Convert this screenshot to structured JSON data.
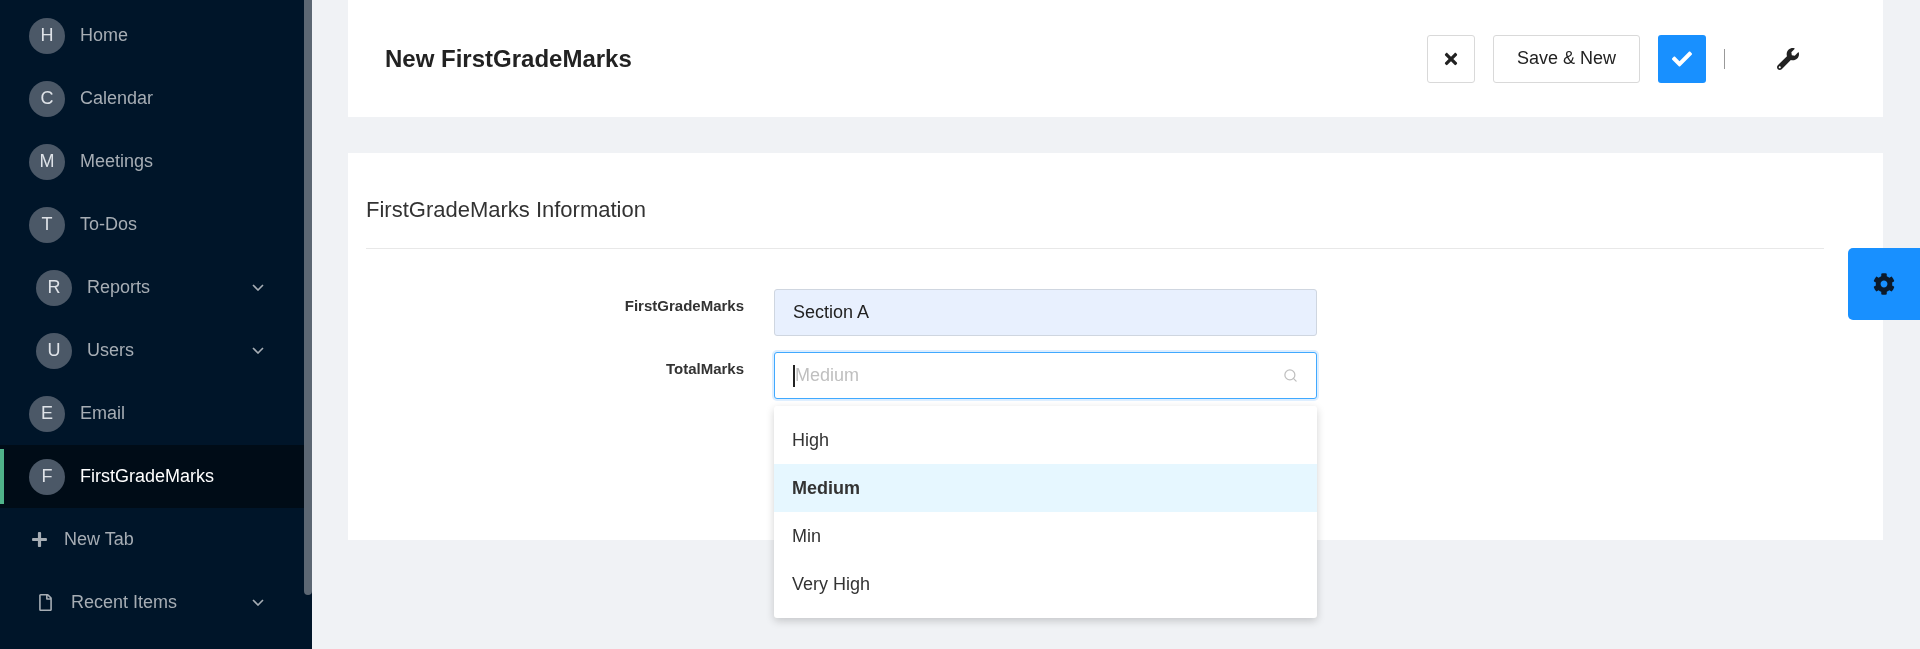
{
  "sidebar": {
    "items": [
      {
        "kind": "item",
        "initial": "H",
        "label": "Home",
        "selected": false
      },
      {
        "kind": "item",
        "initial": "C",
        "label": "Calendar",
        "selected": false
      },
      {
        "kind": "item",
        "initial": "M",
        "label": "Meetings",
        "selected": false
      },
      {
        "kind": "item",
        "initial": "T",
        "label": "To-Dos",
        "selected": false
      },
      {
        "kind": "group",
        "initial": "R",
        "label": "Reports",
        "selected": false
      },
      {
        "kind": "group",
        "initial": "U",
        "label": "Users",
        "selected": false
      },
      {
        "kind": "item",
        "initial": "E",
        "label": "Email",
        "selected": false
      },
      {
        "kind": "item",
        "initial": "F",
        "label": "FirstGradeMarks",
        "selected": true
      },
      {
        "kind": "add",
        "label": "New Tab",
        "selected": false
      },
      {
        "kind": "recent",
        "label": "Recent Items",
        "selected": false
      }
    ]
  },
  "header": {
    "title": "New FirstGradeMarks",
    "save_new_label": "Save & New"
  },
  "form": {
    "title": "FirstGradeMarks Information",
    "fields": [
      {
        "kind": "text",
        "label": "FirstGradeMarks",
        "value": "Section A"
      },
      {
        "kind": "select",
        "label": "TotalMarks",
        "placeholder": "Medium",
        "expanded": true,
        "options": [
          {
            "label": "High",
            "selected": false
          },
          {
            "label": "Medium",
            "selected": true
          },
          {
            "label": "Min",
            "selected": false
          },
          {
            "label": "Very High",
            "selected": false
          }
        ]
      }
    ]
  }
}
